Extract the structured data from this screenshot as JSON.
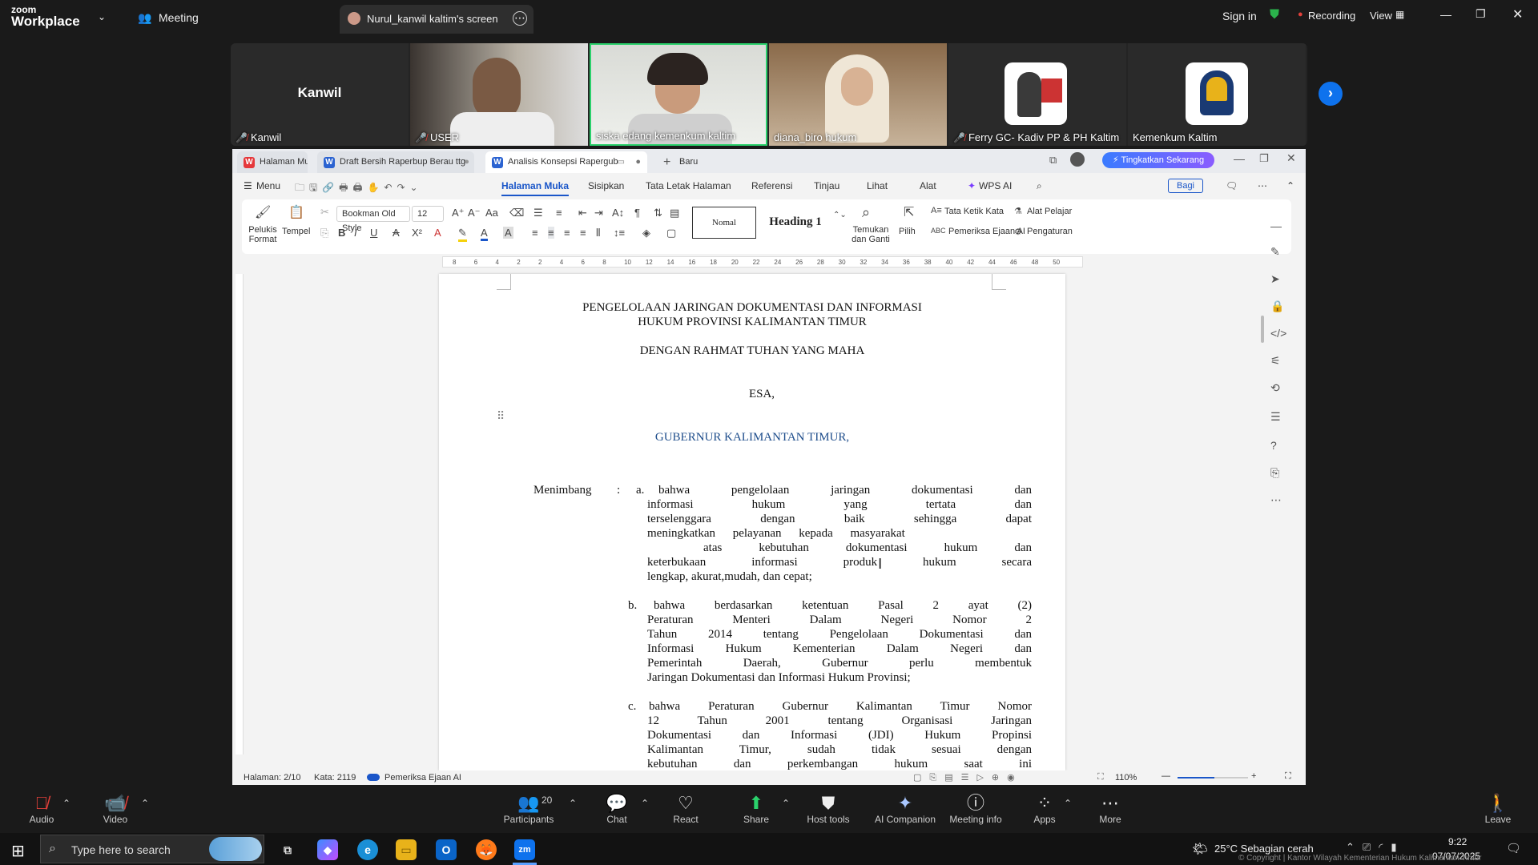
{
  "zoom": {
    "logo_top": "zoom",
    "logo_bottom": "Workplace",
    "meeting_label": "Meeting",
    "share_tab_label": "Nurul_kanwil kaltim's screen",
    "sign_in": "Sign in",
    "recording": "Recording",
    "view": "View"
  },
  "participants": [
    {
      "name": "Kanwil",
      "display": "Kanwil",
      "muted": true
    },
    {
      "name": "USER",
      "muted": true
    },
    {
      "name": "siska edang kemenkum kaltim",
      "muted": false
    },
    {
      "name": "diana_biro hukum",
      "muted": false
    },
    {
      "name": "Ferry GC- Kadiv PP & PH Kaltim",
      "muted": true
    },
    {
      "name": "Kemenkum Kaltim",
      "muted": false
    }
  ],
  "wps": {
    "tabs": [
      {
        "label": "Halaman Mu"
      },
      {
        "label": "Draft Bersih Raperbup Berau ttg"
      },
      {
        "label": "Analisis Konsepsi Rapergub"
      },
      {
        "label": "Baru"
      }
    ],
    "upgrade_button": "Tingkatkan Sekarang",
    "menu_label": "Menu",
    "menu_tabs": [
      "Halaman Muka",
      "Sisipkan",
      "Tata Letak Halaman",
      "Referensi",
      "Tinjau",
      "Lihat",
      "Alat",
      "WPS AI"
    ],
    "share_button": "Bagi",
    "ribbon": {
      "format_painter": "Pelukis Format",
      "paste": "Tempel",
      "font_name": "Bookman Old Style",
      "font_size": "12",
      "style_normal": "Nomal",
      "style_heading": "Heading 1",
      "find_replace": "Temukan dan Ganti",
      "select": "Pilih",
      "text_direction": "Tata Ketik Kata",
      "study_tools": "Alat Pelajar",
      "ai_spellcheck": "Pemeriksa Ejaan AI",
      "settings": "Pengaturan"
    },
    "ruler_numbers": [
      "8",
      "6",
      "4",
      "2",
      "2",
      "4",
      "6",
      "8",
      "10",
      "12",
      "14",
      "16",
      "18",
      "20",
      "22",
      "24",
      "26",
      "28",
      "30",
      "32",
      "34",
      "36",
      "38",
      "40",
      "42",
      "44",
      "46",
      "48",
      "50"
    ],
    "document": {
      "title_line1": "PENGELOLAAN JARINGAN DOKUMENTASI DAN INFORMASI",
      "title_line2": "HUKUM PROVINSI KALIMANTAN TIMUR",
      "rahmat": "DENGAN RAHMAT TUHAN YANG MAHA",
      "esa": "ESA,",
      "gubernur": "GUBERNUR KALIMANTAN TIMUR,",
      "menimbang": "Menimbang",
      "colon": ":",
      "a_marker": "a.",
      "a_lines": [
        "bahwa pengelolaan jaringan dokumentasi dan",
        "informasi hukum yang tertata dan",
        "terselenggara dengan baik sehingga dapat",
        "meningkatkan pelayanan kepada masyarakat",
        "atas kebutuhan dokumentasi hukum dan",
        "keterbukaan informasi produk hukum secara",
        "lengkap, akurat,mudah, dan cepat;"
      ],
      "b_marker": "b.",
      "b_lines": [
        "bahwa berdasarkan ketentuan Pasal 2 ayat (2)",
        "Peraturan Menteri Dalam Negeri Nomor 2",
        "Tahun 2014 tentang Pengelolaan Dokumentasi dan",
        "Informasi Hukum Kementerian Dalam Negeri dan",
        "Pemerintah Daerah, Gubernur perlu membentuk",
        "Jaringan Dokumentasi dan Informasi Hukum Provinsi;"
      ],
      "c_marker": "c.",
      "c_lines": [
        "bahwa Peraturan Gubernur Kalimantan Timur Nomor",
        "12 Tahun 2001 tentang Organisasi Jaringan",
        "Dokumentasi dan Informasi (JDI) Hukum Propinsi",
        "Kalimantan Timur, sudah tidak sesuai dengan",
        "kebutuhan dan perkembangan hukum saat ini"
      ]
    },
    "status": {
      "page": "Halaman: 2/10",
      "words": "Kata: 2119",
      "spellcheck": "Pemeriksa Ejaan AI",
      "zoom": "110%"
    }
  },
  "toolbar": {
    "audio": "Audio",
    "video": "Video",
    "participants": "Participants",
    "participants_count": "20",
    "chat": "Chat",
    "react": "React",
    "share": "Share",
    "host_tools": "Host tools",
    "ai_companion": "AI Companion",
    "meeting_info": "Meeting info",
    "apps": "Apps",
    "more": "More",
    "leave": "Leave"
  },
  "taskbar": {
    "search_placeholder": "Type here to search",
    "weather": "25°C Sebagian cerah",
    "time": "9:22",
    "date": "07/07/2025",
    "watermark": "© Copyright | Kantor Wilayah Kementerian Hukum Kalimantan Timur"
  }
}
